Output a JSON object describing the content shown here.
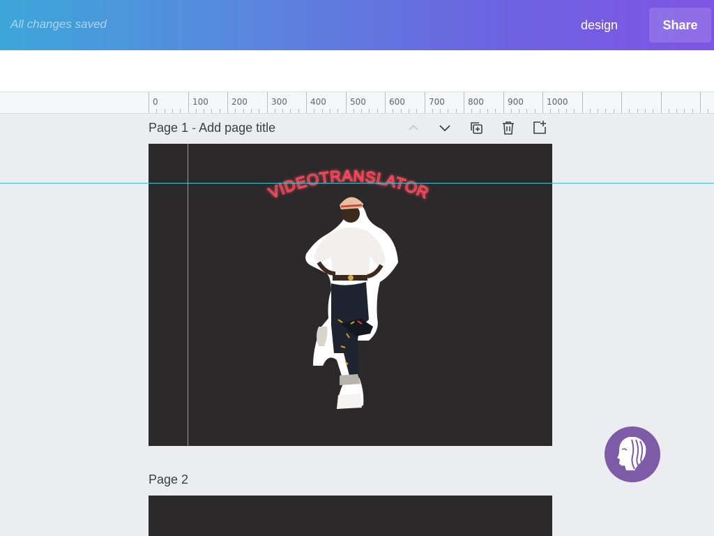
{
  "header": {
    "save_status": "All changes saved",
    "design_label": "design",
    "share_label": "Share"
  },
  "ruler": {
    "labels": [
      "0",
      "100",
      "200",
      "300",
      "400",
      "500",
      "600",
      "700",
      "800",
      "900",
      "1000"
    ]
  },
  "pages": [
    {
      "label": "Page 1",
      "separator": " - ",
      "title_placeholder": "Add page title",
      "canvas_text": "VIDEOTRANSLATOR"
    },
    {
      "label": "Page 2"
    }
  ],
  "page_controls": {
    "icons": [
      "chevron-up-icon",
      "chevron-down-icon",
      "duplicate-page-icon",
      "trash-icon",
      "add-page-icon"
    ]
  },
  "colors": {
    "header_gradient_start": "#3da6d9",
    "header_gradient_end": "#7f55e3",
    "canvas_background": "#2c292a",
    "guide_line": "#39c4d4",
    "neon_text": "#ff4d5e",
    "assistant_background": "#7d5ba6"
  }
}
